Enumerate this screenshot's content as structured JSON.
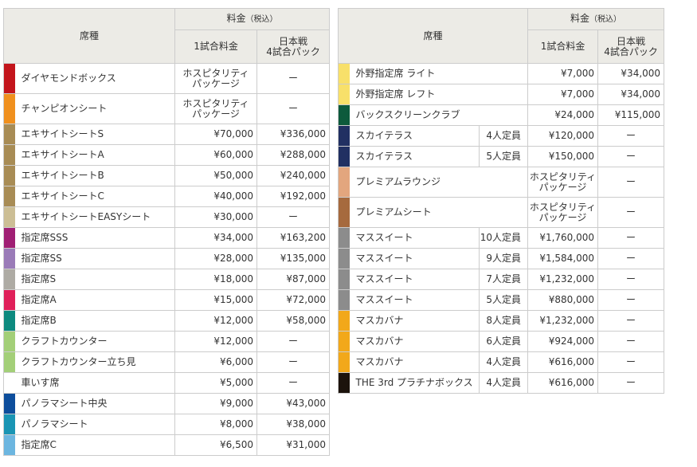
{
  "header": {
    "seat": "席種",
    "fee": "料金",
    "tax": "（税込）",
    "single": "1試合料金",
    "series_line1": "日本戦",
    "series_line2": "4試合パック"
  },
  "hospitality": {
    "line1": "ホスピタリティ",
    "line2": "パッケージ"
  },
  "dash": "ー",
  "left_rows": [
    {
      "color": "#c3151c",
      "name": "ダイヤモンドボックス",
      "single": null,
      "pack": "ー",
      "tall": true
    },
    {
      "color": "#f0901e",
      "name": "チャンピオンシート",
      "single": null,
      "pack": "ー",
      "tall": true
    },
    {
      "color": "#a88c55",
      "name": "エキサイトシートS",
      "single": "¥70,000",
      "pack": "¥336,000"
    },
    {
      "color": "#a88c55",
      "name": "エキサイトシートA",
      "single": "¥60,000",
      "pack": "¥288,000"
    },
    {
      "color": "#a88c55",
      "name": "エキサイトシートB",
      "single": "¥50,000",
      "pack": "¥240,000"
    },
    {
      "color": "#a88c55",
      "name": "エキサイトシートC",
      "single": "¥40,000",
      "pack": "¥192,000"
    },
    {
      "color": "#ccbe95",
      "name": "エキサイトシートEASYシート",
      "single": "¥30,000",
      "pack": "ー"
    },
    {
      "color": "#a01f74",
      "name": "指定席SSS",
      "single": "¥34,000",
      "pack": "¥163,200"
    },
    {
      "color": "#9a7bb8",
      "name": "指定席SS",
      "single": "¥28,000",
      "pack": "¥135,000"
    },
    {
      "color": "#aeaba4",
      "name": "指定席S",
      "single": "¥18,000",
      "pack": "¥87,000"
    },
    {
      "color": "#e0205a",
      "name": "指定席A",
      "single": "¥15,000",
      "pack": "¥72,000"
    },
    {
      "color": "#0d8a7f",
      "name": "指定席B",
      "single": "¥12,000",
      "pack": "¥58,000"
    },
    {
      "color": "#a3cf78",
      "name": "クラフトカウンター",
      "single": "¥12,000",
      "pack": "ー"
    },
    {
      "color": "#a3cf78",
      "name": "クラフトカウンター立ち見",
      "single": "¥6,000",
      "pack": "ー"
    },
    {
      "color": "#ffffff",
      "name": "車いす席",
      "single": "¥5,000",
      "pack": "ー"
    },
    {
      "color": "#0d4e9c",
      "name": "パノラマシート中央",
      "single": "¥9,000",
      "pack": "¥43,000"
    },
    {
      "color": "#1a95b4",
      "name": "パノラマシート",
      "single": "¥8,000",
      "pack": "¥38,000"
    },
    {
      "color": "#6cb6e0",
      "name": "指定席C",
      "single": "¥6,500",
      "pack": "¥31,000"
    }
  ],
  "right_rows": [
    {
      "color": "#f8e06a",
      "name": "外野指定席 ライト",
      "cap": "",
      "single": "¥7,000",
      "pack": "¥34,000"
    },
    {
      "color": "#f8e06a",
      "name": "外野指定席 レフト",
      "cap": "",
      "single": "¥7,000",
      "pack": "¥34,000"
    },
    {
      "color": "#0d5a3c",
      "name": "バックスクリーンクラブ",
      "cap": "",
      "single": "¥24,000",
      "pack": "¥115,000"
    },
    {
      "color": "#213062",
      "name": "スカイテラス",
      "cap": "4人定員",
      "single": "¥120,000",
      "pack": "ー"
    },
    {
      "color": "#213062",
      "name": "スカイテラス",
      "cap": "5人定員",
      "single": "¥150,000",
      "pack": "ー"
    },
    {
      "color": "#e3a67e",
      "name": "プレミアムラウンジ",
      "cap": "",
      "single": null,
      "pack": "ー",
      "tall": true
    },
    {
      "color": "#a66a3e",
      "name": "プレミアムシート",
      "cap": "",
      "single": null,
      "pack": "ー",
      "tall": true
    },
    {
      "color": "#8c8c8c",
      "name": "マススイート",
      "cap": "10人定員",
      "single": "¥1,760,000",
      "pack": "ー"
    },
    {
      "color": "#8c8c8c",
      "name": "マススイート",
      "cap": "9人定員",
      "single": "¥1,584,000",
      "pack": "ー"
    },
    {
      "color": "#8c8c8c",
      "name": "マススイート",
      "cap": "7人定員",
      "single": "¥1,232,000",
      "pack": "ー"
    },
    {
      "color": "#8c8c8c",
      "name": "マススイート",
      "cap": "5人定員",
      "single": "¥880,000",
      "pack": "ー"
    },
    {
      "color": "#f2a81a",
      "name": "マスカバナ",
      "cap": "8人定員",
      "single": "¥1,232,000",
      "pack": "ー"
    },
    {
      "color": "#f2a81a",
      "name": "マスカバナ",
      "cap": "6人定員",
      "single": "¥924,000",
      "pack": "ー"
    },
    {
      "color": "#f2a81a",
      "name": "マスカバナ",
      "cap": "4人定員",
      "single": "¥616,000",
      "pack": "ー"
    },
    {
      "color": "#1c130c",
      "name": "THE 3rd プラチナボックス",
      "cap": "4人定員",
      "single": "¥616,000",
      "pack": "ー"
    }
  ]
}
